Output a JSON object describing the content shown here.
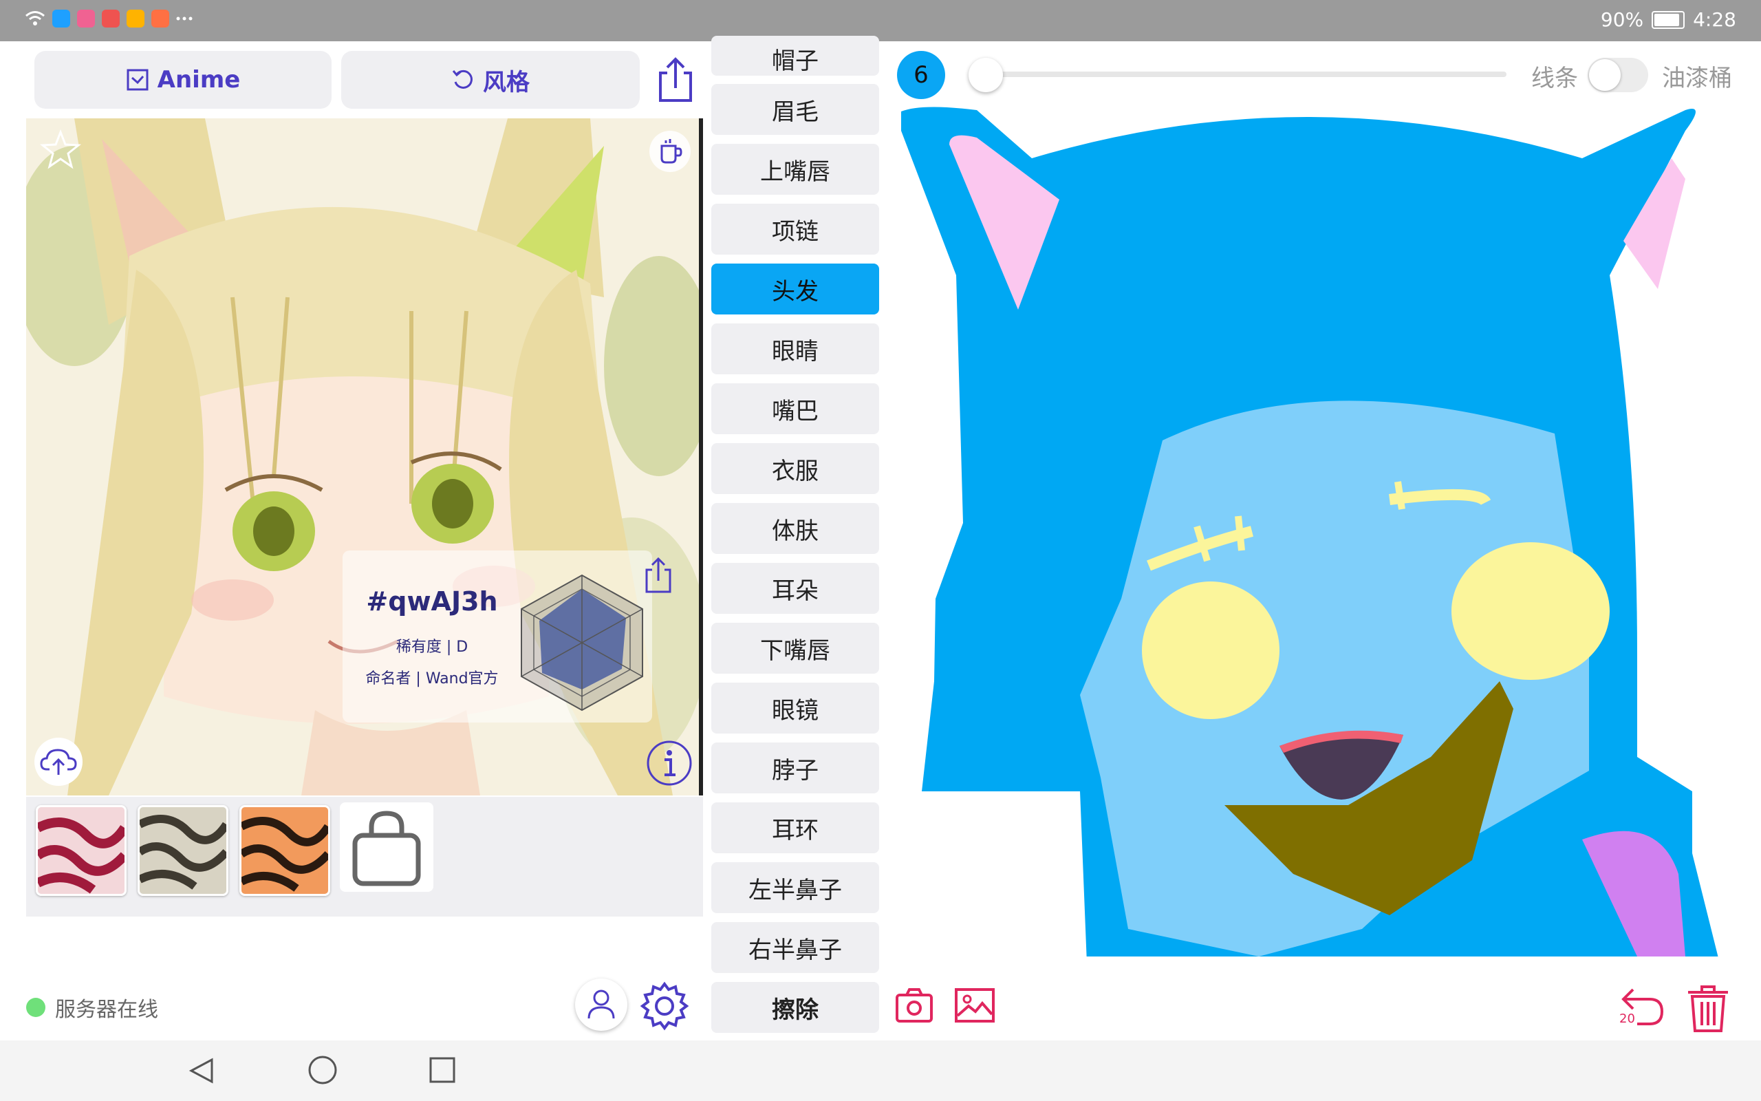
{
  "status_bar": {
    "battery": "90%",
    "time": "4:28",
    "app_icon_colors": [
      "#1ea0ff",
      "#f06292",
      "#ef5350",
      "#ffb300",
      "#ff7043"
    ]
  },
  "top_buttons": {
    "model_label": "Anime",
    "style_label": "风格"
  },
  "character_card": {
    "code": "#qwAJ3h",
    "rarity": "稀有度 | D",
    "author": "命名者 | Wand官方"
  },
  "server": {
    "status": "服务器在线",
    "color": "#6fe07a"
  },
  "parts": {
    "items": [
      "帽子",
      "眉毛",
      "上嘴唇",
      "项链",
      "头发",
      "眼睛",
      "嘴巴",
      "衣服",
      "体肤",
      "耳朵",
      "下嘴唇",
      "眼镜",
      "脖子",
      "耳环",
      "左半鼻子",
      "右半鼻子",
      "擦除"
    ],
    "selected": "头发"
  },
  "brush": {
    "size": "6",
    "slider_fraction": 0.0
  },
  "mode_toggle": {
    "left_label": "线条",
    "right_label": "油漆桶",
    "on": false
  },
  "undo": {
    "count": "20"
  },
  "colors": {
    "accent": "#0aa6f4",
    "button_text": "#4b3cc4",
    "danger": "#e0265e",
    "hair": "#00a8f3",
    "skin": "#7fcffa",
    "eyes": "#fbf59b",
    "ear_inner": "#fbc7ef",
    "mouth": "#4a3a55",
    "lip": "#f06072",
    "clothes": "#7f6f00",
    "clothes_2": "#d080f0"
  }
}
